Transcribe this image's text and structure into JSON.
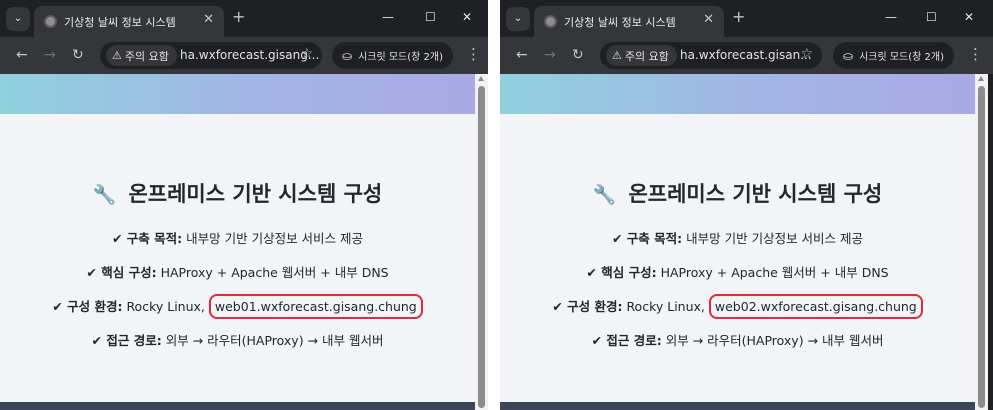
{
  "windows": [
    {
      "tab_title": "기상청 날씨 정보 시스템",
      "security_chip": "주의 요함",
      "url": "ha.wxforecast.gisang...",
      "incognito_label": "시크릿 모드(창 2개)",
      "page": {
        "title": "온프레미스 기반 시스템 구성",
        "lines": [
          {
            "label": "구축 목적:",
            "text": "내부망 기반 기상정보 서비스 제공"
          },
          {
            "label": "핵심 구성:",
            "text": "HAProxy + Apache 웹서버 + 내부 DNS"
          },
          {
            "label": "구성 환경:",
            "text": "Rocky Linux,",
            "highlight": "web01.wxforecast.gisang.chung"
          },
          {
            "label": "접근 경로:",
            "text": "외부 → 라우터(HAProxy) → 내부 웹서버"
          }
        ]
      }
    },
    {
      "tab_title": "기상청 날씨 정보 시스템",
      "security_chip": "주의 요함",
      "url": "ha.wxforecast.gisan...",
      "incognito_label": "시크릿 모드(창 2개)",
      "page": {
        "title": "온프레미스 기반 시스템 구성",
        "lines": [
          {
            "label": "구축 목적:",
            "text": "내부망 기반 기상정보 서비스 제공"
          },
          {
            "label": "핵심 구성:",
            "text": "HAProxy + Apache 웹서버 + 내부 DNS"
          },
          {
            "label": "구성 환경:",
            "text": "Rocky Linux,",
            "highlight": "web02.wxforecast.gisang.chung"
          },
          {
            "label": "접근 경로:",
            "text": "외부 → 라우터(HAProxy) → 내부 웹서버"
          }
        ]
      }
    }
  ],
  "icons": {
    "check": "✔",
    "wrench": "🔧",
    "back": "←",
    "forward": "→",
    "reload": "↻",
    "warning": "⚠",
    "star": "☆",
    "incognito": "⛀",
    "kebab": "⋮",
    "tab_search": "⌄",
    "close": "✕",
    "new_tab": "+",
    "minimize": "—",
    "maximize": "☐"
  },
  "colors": {
    "highlight_border": "#e12b3a",
    "chrome_dark": "#1f2023",
    "chrome_toolbar": "#35363a"
  }
}
